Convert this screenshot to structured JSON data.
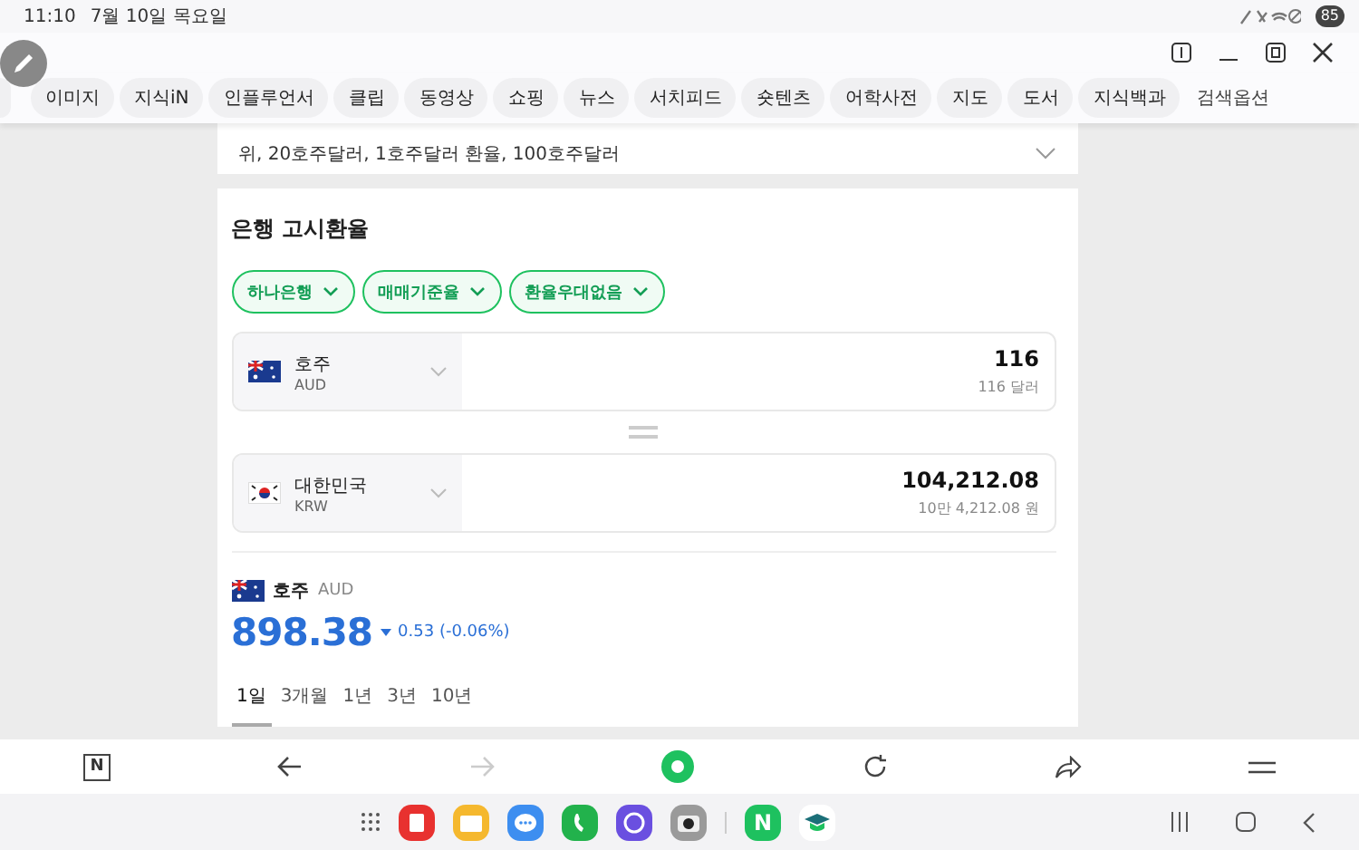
{
  "status_bar": {
    "time": "11:10",
    "date": "7월 10일 목요일",
    "battery": "85"
  },
  "tabs": [
    {
      "label": "이미지",
      "selected": false
    },
    {
      "label": "지식iN",
      "selected": false
    },
    {
      "label": "인플루언서",
      "selected": false
    },
    {
      "label": "클립",
      "selected": false
    },
    {
      "label": "동영상",
      "selected": false
    },
    {
      "label": "쇼핑",
      "selected": false
    },
    {
      "label": "뉴스",
      "selected": false
    },
    {
      "label": "서치피드",
      "selected": false
    },
    {
      "label": "숏텐츠",
      "selected": false
    },
    {
      "label": "어학사전",
      "selected": false
    },
    {
      "label": "지도",
      "selected": false
    },
    {
      "label": "도서",
      "selected": false
    },
    {
      "label": "지식백과",
      "selected": false
    }
  ],
  "search_options": "검색옵션",
  "related": {
    "text": "위, 20호주달러, 1호주달러 환율, 100호주달러"
  },
  "rates": {
    "title": "은행 고시환율",
    "filters": [
      "하나은행",
      "매매기준율",
      "환율우대없음"
    ],
    "converters": [
      {
        "kind": "au",
        "name": "호주",
        "code": "AUD",
        "value": "116",
        "sub": "116 달러"
      },
      {
        "kind": "kr",
        "name": "대한민국",
        "code": "KRW",
        "value": "104,212.08",
        "sub": "10만 4,212.08 원"
      }
    ],
    "summary": {
      "kind": "au",
      "name": "호주",
      "code": "AUD",
      "rate": "898.38",
      "falling": true,
      "change": "0.53 (-0.06%)"
    },
    "periods": [
      {
        "label": "1일",
        "selected": true
      },
      {
        "label": "3개월",
        "selected": false
      },
      {
        "label": "1년",
        "selected": false
      },
      {
        "label": "3년",
        "selected": false
      },
      {
        "label": "10년",
        "selected": false
      }
    ]
  },
  "toolbar": [
    {
      "kind": "logo",
      "label": "N",
      "disabled": false
    },
    {
      "kind": "back",
      "disabled": false
    },
    {
      "kind": "forward",
      "disabled": true
    },
    {
      "kind": "home",
      "disabled": false
    },
    {
      "kind": "reload",
      "disabled": false
    },
    {
      "kind": "share",
      "disabled": false
    },
    {
      "kind": "menu",
      "disabled": false
    }
  ],
  "dock": [
    {
      "kind": "notes",
      "color": "#e8312f"
    },
    {
      "kind": "files",
      "color": "#f5b82e"
    },
    {
      "kind": "messages",
      "color": "#3d8ef0"
    },
    {
      "kind": "phone",
      "color": "#22b24c"
    },
    {
      "kind": "browser",
      "color": "#6a4fe0"
    },
    {
      "kind": "camera",
      "color": "#9a9a9a"
    },
    {
      "kind": "naver",
      "color": "#1ec15f",
      "label": "N"
    },
    {
      "kind": "edu",
      "color": "#ffffff"
    }
  ]
}
